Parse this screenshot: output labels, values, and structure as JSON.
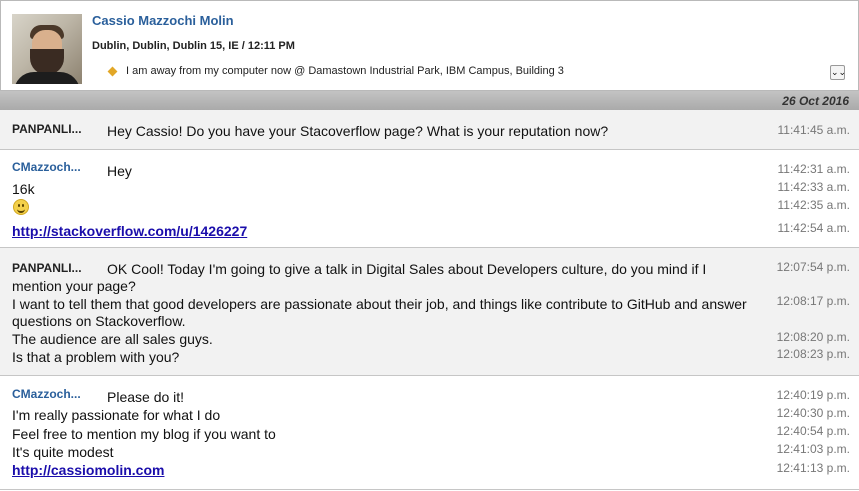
{
  "profile": {
    "name": "Cassio Mazzochi Molin",
    "location": "Dublin, Dublin, Dublin 15, IE / 12:11 PM",
    "status": "I am away from my computer now @ Damastown Industrial Park, IBM Campus, Building 3",
    "expand_icon": "double-chevron-down-icon",
    "expand_glyph": "⌄⌄"
  },
  "conversation": {
    "date": "26 Oct 2016",
    "groups": [
      {
        "sender": "PANPANLI...",
        "messages": [
          {
            "text": "Hey Cassio! Do you have your Stacoverflow page? What is your reputation now?",
            "time": "11:41:45 a.m."
          }
        ]
      },
      {
        "sender": "CMazzoch...",
        "messages": [
          {
            "text": "Hey",
            "time": "11:42:31 a.m."
          },
          {
            "text": "16k",
            "time": "11:42:33 a.m."
          },
          {
            "emoji": "smile-icon",
            "time": "11:42:35 a.m."
          },
          {
            "link": "http://stackoverflow.com/u/1426227",
            "time": "11:42:54 a.m."
          }
        ]
      },
      {
        "sender": "PANPANLI...",
        "messages": [
          {
            "text": "OK Cool! Today I'm going to give a talk in Digital Sales about Developers culture, do you mind if I mention your page?",
            "time": "12:07:54 p.m."
          },
          {
            "text": "I want to tell them that good developers are passionate about their job, and things like contribute to GitHub and answer questions on Stackoverflow.",
            "time": "12:08:17 p.m."
          },
          {
            "text": "The audience are all sales guys.",
            "time": "12:08:20 p.m."
          },
          {
            "text": "Is that a problem with you?",
            "time": "12:08:23 p.m."
          }
        ]
      },
      {
        "sender": "CMazzoch...",
        "messages": [
          {
            "text": "Please do it!",
            "time": "12:40:19 p.m."
          },
          {
            "text": "I'm really passionate for what I do",
            "time": "12:40:30 p.m."
          },
          {
            "text": "Feel free to mention my blog if you want to",
            "time": "12:40:54 p.m."
          },
          {
            "text": "It's quite modest",
            "time": "12:41:03 p.m."
          },
          {
            "link": "http://cassiomolin.com",
            "time": "12:41:13 p.m."
          }
        ]
      }
    ]
  }
}
